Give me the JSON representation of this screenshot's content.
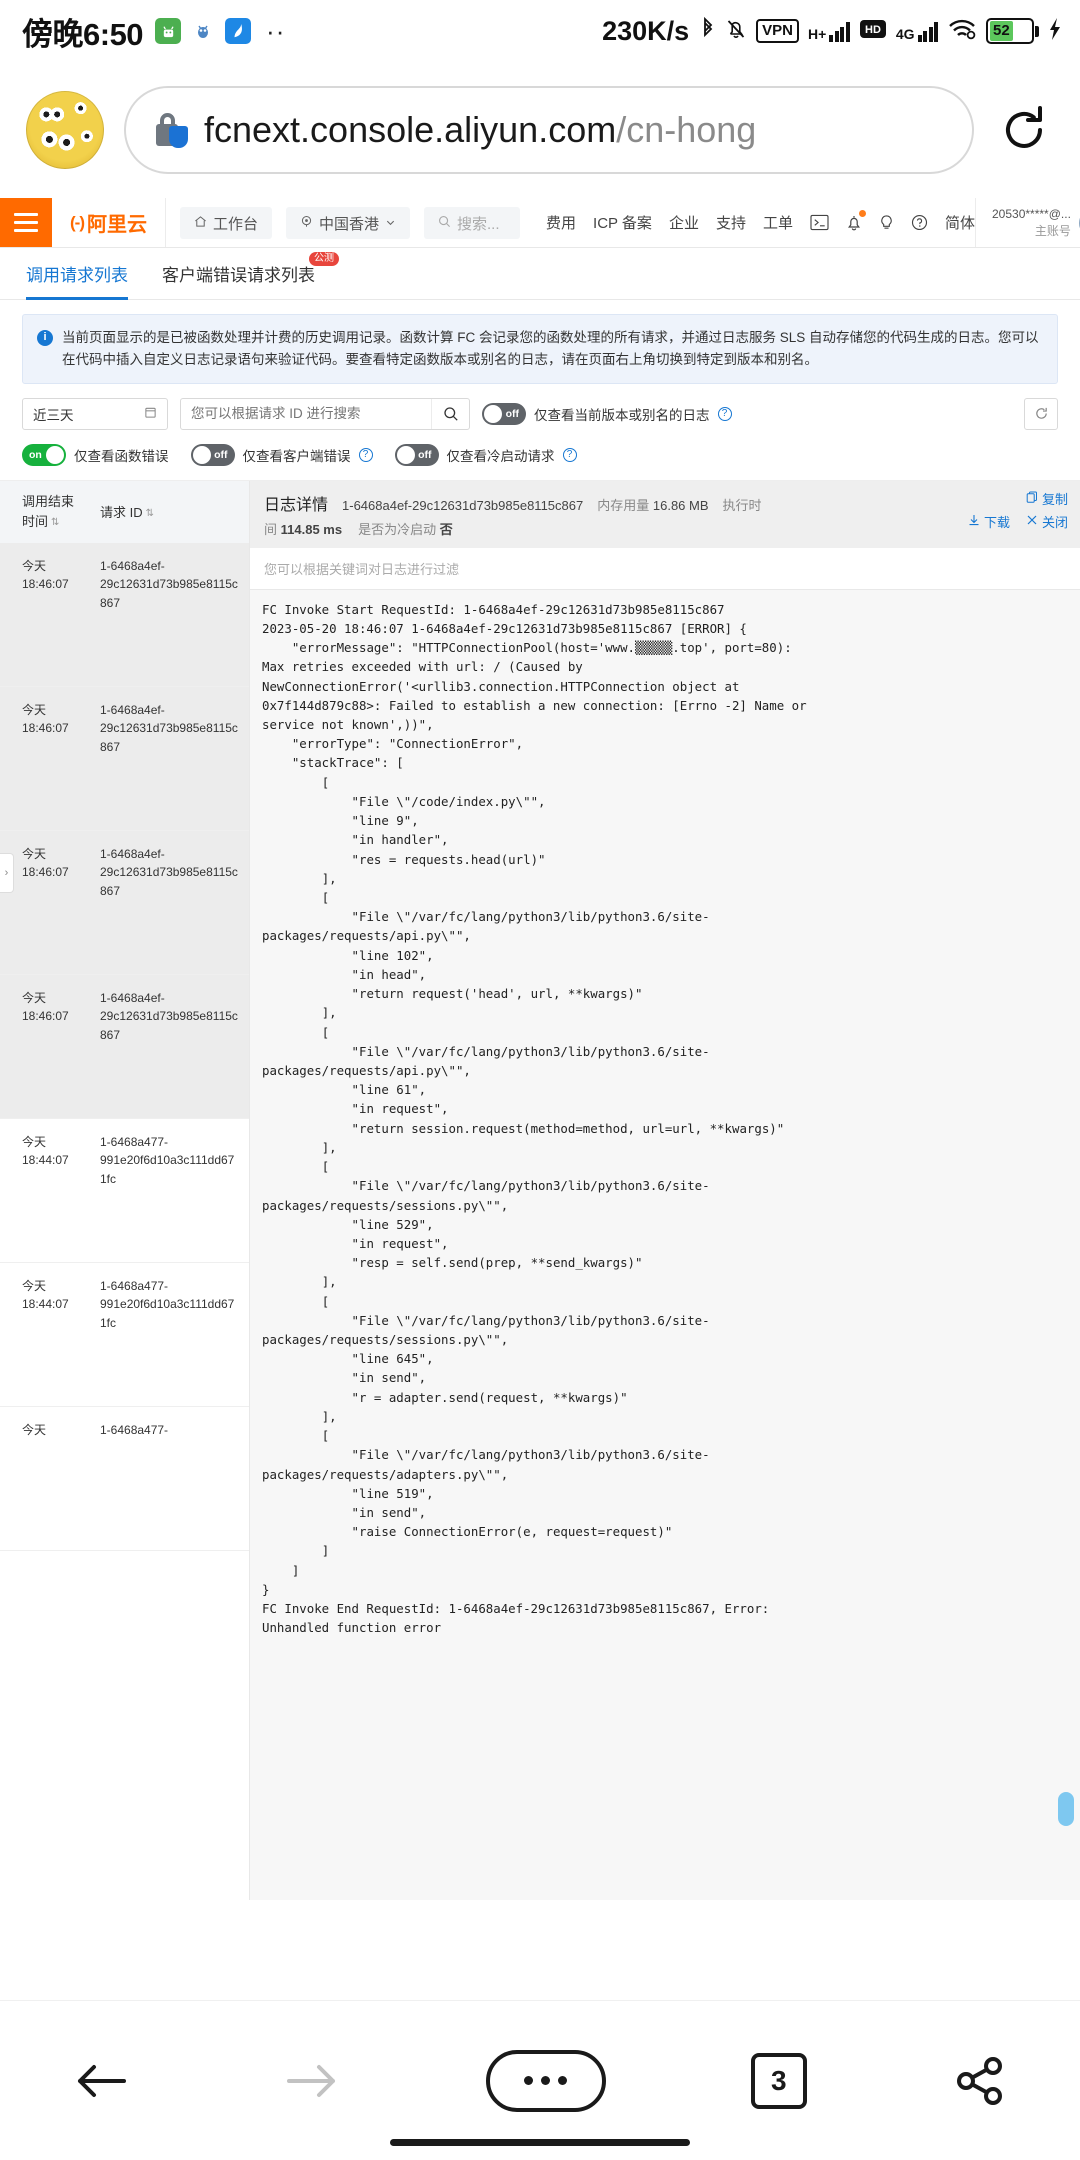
{
  "statusbar": {
    "time": "傍晚6:50",
    "network_speed": "230K/s",
    "vpn_label": "VPN",
    "hplus_label": "H+",
    "hd_label": "HD",
    "fourg_label": "4G",
    "battery_level": "52",
    "app_icons": [
      "android-app-icon",
      "bug-app-icon",
      "swan-app-icon",
      "more-dots-icon"
    ]
  },
  "browser": {
    "url_host": "fcnext.console.aliyun.com",
    "url_path": "/cn-hong",
    "reload_label": "reload-icon",
    "avatar_label": "minions-avatar"
  },
  "aliyun_header": {
    "logo_mark": "(-)",
    "logo_name": "阿里云",
    "workbench": "工作台",
    "region": "中国香港",
    "search_placeholder": "搜索...",
    "nav_items": [
      "费用",
      "ICP 备案",
      "企业",
      "支持",
      "工单"
    ],
    "language": "简体",
    "account": "20530*****@...",
    "account_role": "主账号"
  },
  "tabs": [
    {
      "label": "调用请求列表",
      "active": true,
      "badge": ""
    },
    {
      "label": "客户端错误请求列表",
      "active": false,
      "badge": "公测"
    }
  ],
  "info_banner": {
    "text": "当前页面显示的是已被函数处理并计费的历史调用记录。函数计算 FC 会记录您的函数处理的所有请求，并通过日志服务 SLS 自动存储您的代码生成的日志。您可以在代码中插入自定义日志记录语句来验证代码。要查看特定函数版本或别名的日志，请在页面右上角切换到特定到版本和别名。",
    "icon": "info-icon"
  },
  "filters": {
    "date_range": "近三天",
    "date_icon": "calendar-icon",
    "search_placeholder": "您可以根据请求 ID 进行搜索",
    "search_value": "",
    "search_icon": "search-icon",
    "refresh_icon": "refresh-icon",
    "toggles": [
      {
        "label": "仅查看当前版本或别名的日志",
        "state": "off",
        "help": true
      },
      {
        "label": "仅查看函数错误",
        "state": "on",
        "help": false
      },
      {
        "label": "仅查看客户端错误",
        "state": "off",
        "help": true
      },
      {
        "label": "仅查看冷启动请求",
        "state": "off",
        "help": true
      }
    ]
  },
  "table": {
    "columns": [
      "调用结束\n时间",
      "请求 ID"
    ],
    "col1_line1": "调用结束",
    "col1_line2": "时间",
    "col2": "请求 ID",
    "rows": [
      {
        "day": "今天",
        "time": "18:46:07",
        "rid_line1": "1-6468a4ef-",
        "rid_line2": "29c12631d73b985e8115c867",
        "selected": true
      },
      {
        "day": "今天",
        "time": "18:46:07",
        "rid_line1": "1-6468a4ef-",
        "rid_line2": "29c12631d73b985e8115c867",
        "selected": true
      },
      {
        "day": "今天",
        "time": "18:46:07",
        "rid_line1": "1-6468a4ef-",
        "rid_line2": "29c12631d73b985e8115c867",
        "selected": true
      },
      {
        "day": "今天",
        "time": "18:46:07",
        "rid_line1": "1-6468a4ef-",
        "rid_line2": "29c12631d73b985e8115c867",
        "selected": true
      },
      {
        "day": "今天",
        "time": "18:44:07",
        "rid_line1": "1-6468a477-",
        "rid_line2": "991e20f6d10a3c111dd671fc",
        "selected": false
      },
      {
        "day": "今天",
        "time": "18:44:07",
        "rid_line1": "1-6468a477-",
        "rid_line2": "991e20f6d10a3c111dd671fc",
        "selected": false
      },
      {
        "day": "今天",
        "time": "",
        "rid_line1": "1-6468a477-",
        "rid_line2": "",
        "selected": false
      }
    ]
  },
  "detail": {
    "title": "日志详情",
    "request_id": "1-6468a4ef-29c12631d73b985e8115c867",
    "memory_label": "内存用量",
    "memory_value": "16.86 MB",
    "duration_label": "执行时间",
    "duration_label_short": "执行时",
    "duration_label_wrap": "间",
    "duration_value": "114.85 ms",
    "coldstart_label": "是否为冷启动",
    "coldstart_value": "否",
    "copy_label": "复制",
    "copy_icon": "copy-icon",
    "download_label": "下载",
    "download_icon": "download-icon",
    "close_label": "关闭",
    "close_icon": "close-icon",
    "filter_placeholder": "您可以根据关键词对日志进行过滤",
    "log_text": "FC Invoke Start RequestId: 1-6468a4ef-29c12631d73b985e8115c867\n2023-05-20 18:46:07 1-6468a4ef-29c12631d73b985e8115c867 [ERROR] {\n    \"errorMessage\": \"HTTPConnectionPool(host='www.▒▒▒▒▒.top', port=80):\nMax retries exceeded with url: / (Caused by\nNewConnectionError('<urllib3.connection.HTTPConnection object at\n0x7f144d879c88>: Failed to establish a new connection: [Errno -2] Name or\nservice not known',))\",\n    \"errorType\": \"ConnectionError\",\n    \"stackTrace\": [\n        [\n            \"File \\\"/code/index.py\\\"\",\n            \"line 9\",\n            \"in handler\",\n            \"res = requests.head(url)\"\n        ],\n        [\n            \"File \\\"/var/fc/lang/python3/lib/python3.6/site-\npackages/requests/api.py\\\"\",\n            \"line 102\",\n            \"in head\",\n            \"return request('head', url, **kwargs)\"\n        ],\n        [\n            \"File \\\"/var/fc/lang/python3/lib/python3.6/site-\npackages/requests/api.py\\\"\",\n            \"line 61\",\n            \"in request\",\n            \"return session.request(method=method, url=url, **kwargs)\"\n        ],\n        [\n            \"File \\\"/var/fc/lang/python3/lib/python3.6/site-\npackages/requests/sessions.py\\\"\",\n            \"line 529\",\n            \"in request\",\n            \"resp = self.send(prep, **send_kwargs)\"\n        ],\n        [\n            \"File \\\"/var/fc/lang/python3/lib/python3.6/site-\npackages/requests/sessions.py\\\"\",\n            \"line 645\",\n            \"in send\",\n            \"r = adapter.send(request, **kwargs)\"\n        ],\n        [\n            \"File \\\"/var/fc/lang/python3/lib/python3.6/site-\npackages/requests/adapters.py\\\"\",\n            \"line 519\",\n            \"in send\",\n            \"raise ConnectionError(e, request=request)\"\n        ]\n    ]\n}\nFC Invoke End RequestId: 1-6468a4ef-29c12631d73b985e8115c867, Error:\nUnhandled function error"
  },
  "bottom_nav": {
    "back_icon": "back-arrow-icon",
    "forward_icon": "forward-arrow-icon",
    "menu_icon": "menu-dots-icon",
    "tab_count": "3",
    "share_icon": "share-icon"
  }
}
